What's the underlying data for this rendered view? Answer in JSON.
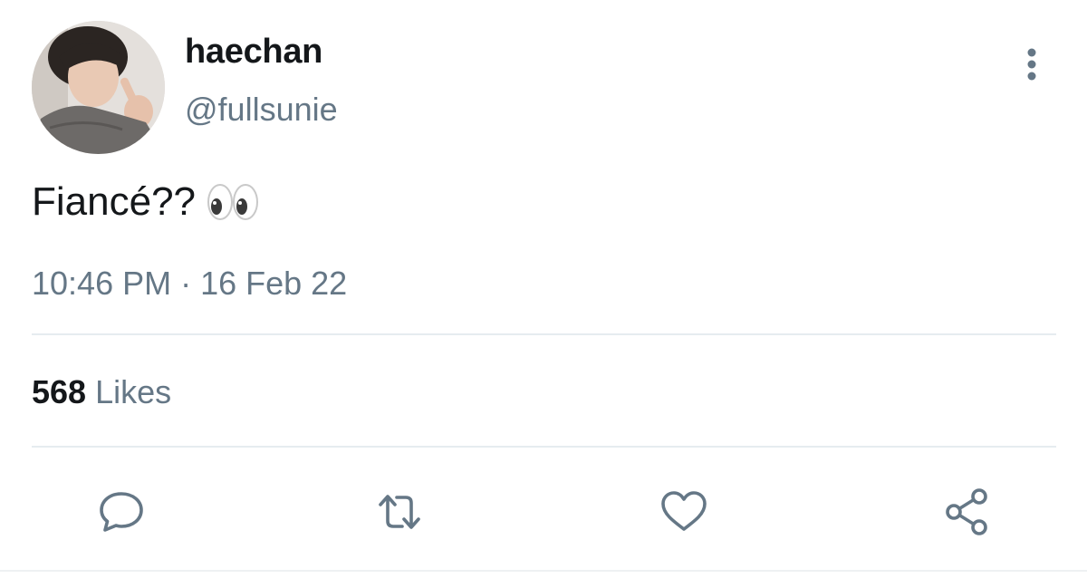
{
  "tweet": {
    "author": {
      "display_name": "haechan",
      "handle": "@fullsunie",
      "avatar_icon": "profile-photo"
    },
    "text": "Fiancé??",
    "emoji": "👀",
    "timestamp": "10:46 PM · 16 Feb 22",
    "likes": {
      "count": "568",
      "label": "Likes"
    },
    "actions": [
      {
        "name": "reply",
        "icon": "speech-bubble-icon"
      },
      {
        "name": "retweet",
        "icon": "retweet-icon"
      },
      {
        "name": "like",
        "icon": "heart-icon"
      },
      {
        "name": "share",
        "icon": "share-icon"
      }
    ]
  },
  "colors": {
    "primary_text": "#14171a",
    "secondary_text": "#657786",
    "divider": "#e6ecf0",
    "icon": "#657786"
  }
}
